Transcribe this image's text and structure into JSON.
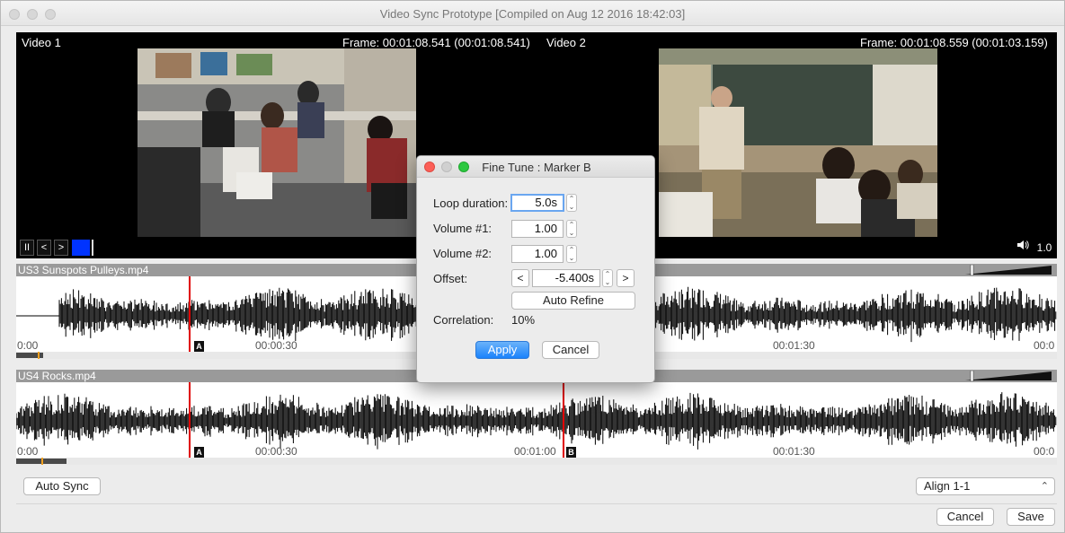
{
  "window": {
    "title": "Video Sync Prototype [Compiled on Aug 12 2016 18:42:03]"
  },
  "video1": {
    "label": "Video 1",
    "frame": "Frame: 00:01:08.541 (00:01:08.541)"
  },
  "video2": {
    "label": "Video 2",
    "frame": "Frame: 00:01:08.559 (00:01:03.159)"
  },
  "controls": {
    "pause": "II",
    "prev": "<",
    "next": ">",
    "volume_icon": "speaker-icon",
    "speed": "1.0"
  },
  "track1": {
    "name": "US3 Sunspots Pulleys.mp4",
    "time_labels": [
      "0:00",
      "00:00:30",
      "00:01:30",
      "00:0"
    ],
    "markers": [
      "A"
    ]
  },
  "track2": {
    "name": "US4 Rocks.mp4",
    "time_labels": [
      "0:00",
      "00:00:30",
      "00:01:00",
      "00:01:30",
      "00:0"
    ],
    "markers": [
      "A",
      "B"
    ]
  },
  "bottom": {
    "auto_sync": "Auto Sync",
    "align_select": "Align 1-1",
    "cancel": "Cancel",
    "save": "Save"
  },
  "dialog": {
    "title": "Fine Tune : Marker B",
    "loop_duration_label": "Loop duration:",
    "loop_duration_value": "5.0s",
    "volume1_label": "Volume #1:",
    "volume1_value": "1.00",
    "volume2_label": "Volume #2:",
    "volume2_value": "1.00",
    "offset_label": "Offset:",
    "offset_value": "-5.400s",
    "offset_dec": "<",
    "offset_inc": ">",
    "auto_refine": "Auto Refine",
    "correlation_label": "Correlation:",
    "correlation_value": "10%",
    "apply": "Apply",
    "cancel": "Cancel"
  },
  "colors": {
    "accent": "#1a82fb",
    "marker": "#e00000",
    "position_box": "#0033ff"
  }
}
